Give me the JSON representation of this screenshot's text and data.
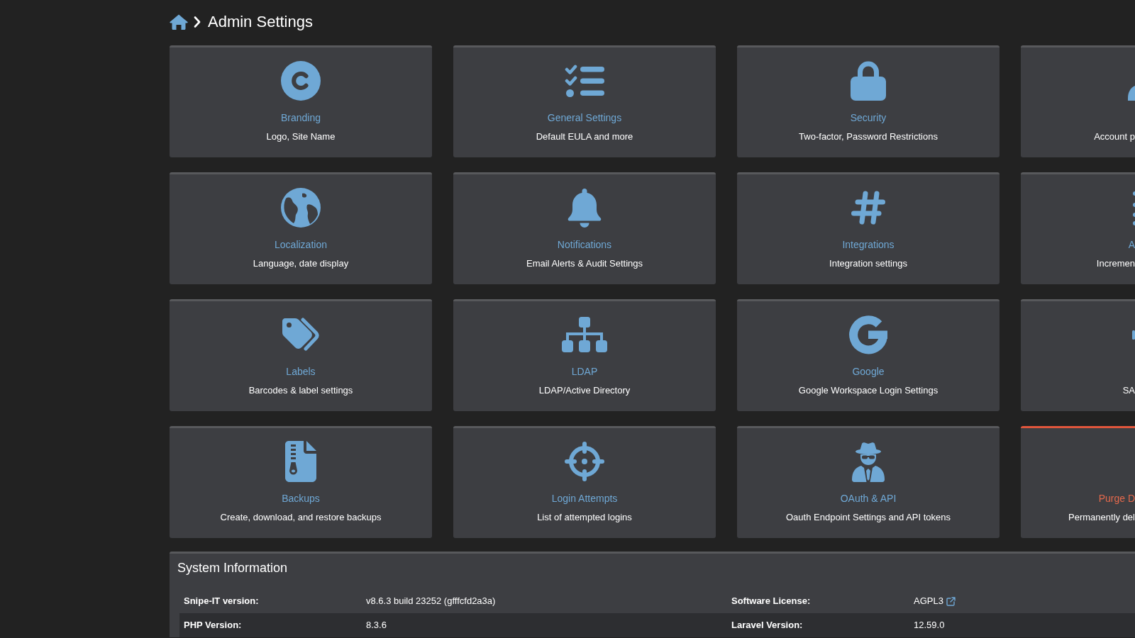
{
  "breadcrumb": {
    "title": "Admin Settings"
  },
  "cards": [
    {
      "title": "Branding",
      "description": "Logo, Site Name",
      "kind": "default"
    },
    {
      "title": "General Settings",
      "description": "Default EULA and more",
      "kind": "default"
    },
    {
      "title": "Security",
      "description": "Two-factor, Password Restrictions",
      "kind": "default"
    },
    {
      "description": "Account p",
      "kind": "default"
    },
    {
      "title": "Localization",
      "description": "Language, date display",
      "kind": "default"
    },
    {
      "title": "Notifications",
      "description": "Email Alerts & Audit Settings",
      "kind": "default"
    },
    {
      "title": "Integrations",
      "description": "Integration settings",
      "kind": "default"
    },
    {
      "title": "A",
      "description": "Incremen",
      "kind": "default"
    },
    {
      "title": "Labels",
      "description": "Barcodes & label settings",
      "kind": "default"
    },
    {
      "title": "LDAP",
      "description": "LDAP/Active Directory",
      "kind": "default"
    },
    {
      "title": "Google",
      "description": "Google Workspace Login Settings",
      "kind": "default"
    },
    {
      "description": "SA",
      "kind": "default"
    },
    {
      "title": "Backups",
      "description": "Create, download, and restore backups",
      "kind": "default"
    },
    {
      "title": "Login Attempts",
      "description": "List of attempted logins",
      "kind": "default"
    },
    {
      "title": "OAuth & API",
      "description": "Oauth Endpoint Settings and API tokens",
      "kind": "default"
    },
    {
      "title": "Purge D",
      "description": "Permanently del",
      "kind": "danger"
    }
  ],
  "system_information": {
    "title": "System Information",
    "rows": [
      {
        "items": [
          {
            "label": "Snipe-IT version:",
            "value": "v8.6.3 build 23252 (gfffcfd2a3a)",
            "external_link": false
          },
          {
            "label": "Software License:",
            "value": "AGPL3",
            "external_link": true
          }
        ]
      },
      {
        "items": [
          {
            "label": "PHP Version:",
            "value": "8.3.6",
            "external_link": false
          },
          {
            "label": "Laravel Version:",
            "value": "12.59.0",
            "external_link": false
          }
        ]
      }
    ]
  }
}
